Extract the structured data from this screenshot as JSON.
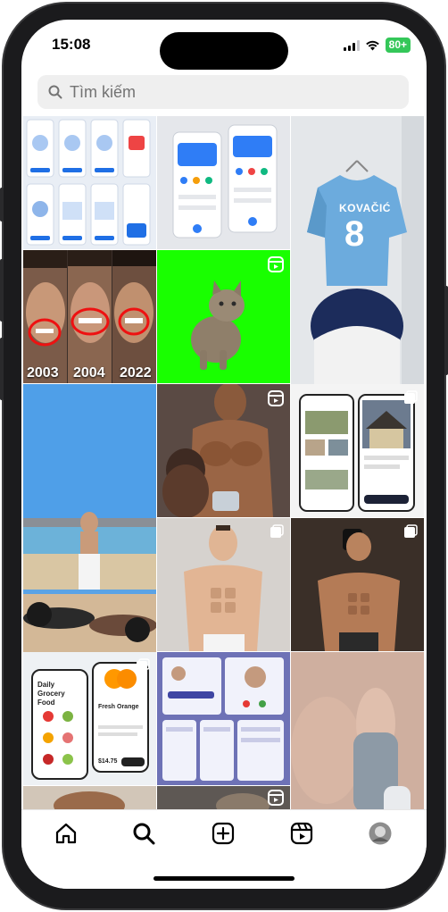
{
  "status": {
    "time": "15:08",
    "battery": "80+"
  },
  "search": {
    "placeholder": "Tìm kiếm"
  },
  "tiles": {
    "t1": {
      "kind": "app-screens",
      "badge": "none"
    },
    "t2": {
      "kind": "bank-app",
      "badge": "none"
    },
    "t3": {
      "kind": "jersey",
      "text": "KOVAČIĆ",
      "number": "8",
      "badge": "none"
    },
    "t4": {
      "kind": "faces",
      "years": [
        "2003",
        "2004",
        "2022"
      ],
      "badge": "none"
    },
    "t5": {
      "kind": "cat-green",
      "badge": "reel-icon"
    },
    "t6": {
      "kind": "beach",
      "badge": "none"
    },
    "t7": {
      "kind": "muscle",
      "badge": "reel-icon"
    },
    "t8": {
      "kind": "property-app",
      "badge": "carousel-icon"
    },
    "t9": {
      "kind": "beach2",
      "badge": "none"
    },
    "t10": {
      "kind": "muscle2",
      "badge": "carousel-icon"
    },
    "t11": {
      "kind": "muscle3",
      "badge": "carousel-icon"
    },
    "t12": {
      "kind": "grocery-app",
      "title": "Daily Grocery Food",
      "product": "Fresh Orange",
      "price": "$14.75",
      "badge": "carousel-icon"
    },
    "t13": {
      "kind": "profile-app",
      "badge": "none"
    },
    "t14": {
      "kind": "toe",
      "badge": "none"
    }
  },
  "nav": [
    "home-icon",
    "search-icon",
    "create-icon",
    "reels-icon",
    "profile-avatar"
  ],
  "colors": {
    "accent_green": "#34c759",
    "cat_green": "#19ff00",
    "jersey_blue": "#6cabdd"
  }
}
